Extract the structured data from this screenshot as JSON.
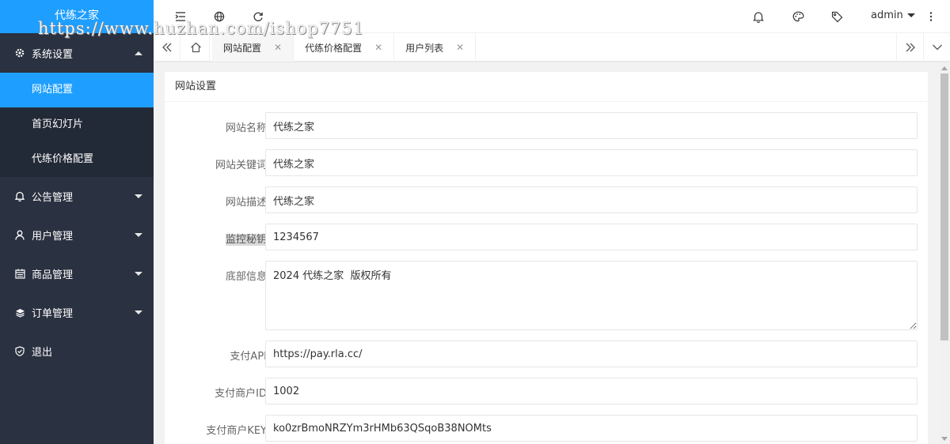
{
  "app": {
    "logo_text": "代练之家"
  },
  "watermark": "https://www.huzhan.com/ishop7751",
  "sidebar": {
    "items": [
      {
        "label": "系统设置",
        "icon": "gear-icon",
        "expanded": true,
        "children": [
          {
            "label": "网站配置",
            "active": true
          },
          {
            "label": "首页幻灯片"
          },
          {
            "label": "代练价格配置"
          }
        ]
      },
      {
        "label": "公告管理",
        "icon": "bell-icon"
      },
      {
        "label": "用户管理",
        "icon": "user-icon"
      },
      {
        "label": "商品管理",
        "icon": "calendar-icon"
      },
      {
        "label": "订单管理",
        "icon": "layers-icon"
      },
      {
        "label": "退出",
        "icon": "shield-icon"
      }
    ]
  },
  "header": {
    "icons": [
      "menu-collapse-icon",
      "globe-icon",
      "refresh-icon",
      "notification-bell-icon",
      "theme-palette-icon",
      "tag-icon",
      "more-vertical-icon"
    ],
    "user": "admin"
  },
  "tabs": {
    "items": [
      {
        "label": "网站配置",
        "active": true
      },
      {
        "label": "代练价格配置"
      },
      {
        "label": "用户列表"
      }
    ]
  },
  "form": {
    "title": "网站设置",
    "fields": [
      {
        "label": "网站名称",
        "value": "代练之家"
      },
      {
        "label": "网站关键词",
        "value": "代练之家"
      },
      {
        "label": "网站描述",
        "value": "代练之家"
      },
      {
        "label": "监控秘钥",
        "value": "1234567",
        "label_highlighted": true
      },
      {
        "label": "底部信息",
        "value": "2024 代练之家  版权所有",
        "multiline": true
      },
      {
        "label": "支付API",
        "value": "https://pay.rla.cc/"
      },
      {
        "label": "支付商户ID",
        "value": "1002"
      },
      {
        "label": "支付商户KEY",
        "value": "ko0zrBmoNRZYm3rHMb63QSqoB38NOMts"
      }
    ]
  },
  "colors": {
    "sidebar_bg": "#2a3140",
    "submenu_bg": "#232a37",
    "accent": "#1e9fff",
    "page_bg": "#f2f2f2"
  }
}
